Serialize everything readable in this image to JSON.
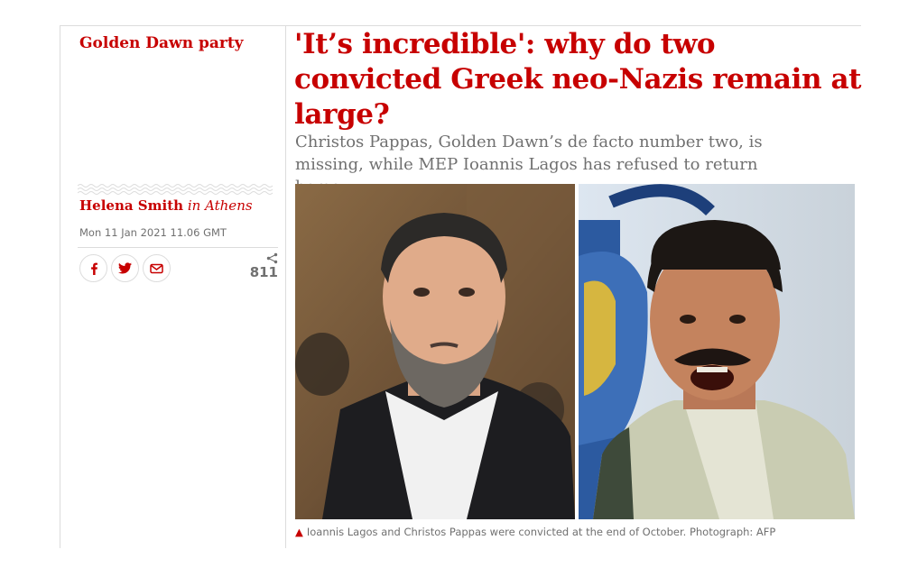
{
  "article": {
    "section": "Golden Dawn party",
    "headline": "'It’s incredible': why do two convicted Greek neo-Nazis remain at large?",
    "standfirst": "Christos Pappas, Golden Dawn’s de facto number two, is missing, while MEP Ioannis Lagos has refused to return home",
    "byline": {
      "author": "Helena Smith",
      "location": "in Athens"
    },
    "dateline": "Mon 11 Jan 2021 11.06 GMT",
    "share": {
      "icons": [
        "facebook-icon",
        "twitter-icon",
        "email-icon",
        "share-icon"
      ],
      "count": "811"
    },
    "image": {
      "caption": "Ioannis Lagos and Christos Pappas were convicted at the end of October. Photograph: AFP"
    }
  },
  "colors": {
    "accent": "#c70000",
    "muted_text": "#707070",
    "rule": "#dcdcdc"
  }
}
